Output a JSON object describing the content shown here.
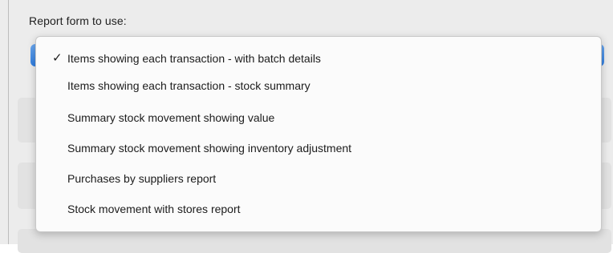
{
  "form": {
    "label": "Report form to use:"
  },
  "dropdown": {
    "selected_index": 0,
    "check_glyph": "✓",
    "items": [
      {
        "label": "Items showing each transaction - with batch details",
        "checked": true
      },
      {
        "label": "Items showing each transaction - stock summary",
        "checked": false
      },
      {
        "label": "Summary stock movement showing value",
        "checked": false
      },
      {
        "label": "Summary stock movement showing inventory adjustment",
        "checked": false
      },
      {
        "label": "Purchases by suppliers report",
        "checked": false
      },
      {
        "label": "Stock movement with stores report",
        "checked": false
      }
    ]
  },
  "colors": {
    "popup_button_accent": "#2f7de0",
    "menu_background": "#fbfbfb",
    "window_background": "#ececec"
  }
}
